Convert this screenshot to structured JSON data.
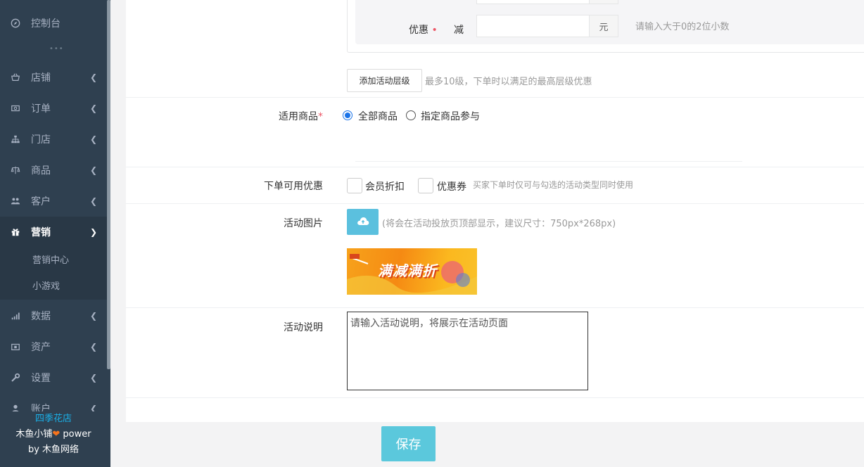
{
  "sidebar": {
    "top_item": "控制台",
    "dots": "•••",
    "items": [
      {
        "label": "店铺",
        "icon": "shop-icon"
      },
      {
        "label": "订单",
        "icon": "money-icon"
      },
      {
        "label": "门店",
        "icon": "sitemap-icon"
      },
      {
        "label": "商品",
        "icon": "balance-icon"
      },
      {
        "label": "客户",
        "icon": "users-icon"
      },
      {
        "label": "营销",
        "icon": "gift-icon"
      },
      {
        "label": "数据",
        "icon": "bar-chart-icon"
      },
      {
        "label": "资产",
        "icon": "wallet-icon"
      },
      {
        "label": "设置",
        "icon": "wrench-icon"
      },
      {
        "label": "账户",
        "icon": "user-icon"
      }
    ],
    "submenu": [
      "营销中心",
      "小游戏"
    ],
    "footer": {
      "shop_name": "四季花店",
      "brand": "木鱼小铺",
      "power": " power",
      "by": "by 木鱼网络"
    }
  },
  "form": {
    "discount_label": "优惠",
    "required_mark": "•",
    "minus_label": "减",
    "unit": "元",
    "discount_hint": "请输入大于0的2位小数",
    "add_tier_button": "添加活动层级",
    "add_tier_hint": "最多10级，下单时以满足的最高层级优惠",
    "goods_label": "适用商品",
    "goods_required": "*",
    "goods_options": [
      "全部商品",
      "指定商品参与"
    ],
    "combinable_label": "下单可用优惠",
    "combinable_options": [
      "会员折扣",
      "优惠券"
    ],
    "combinable_hint": "买家下单时仅可与勾选的活动类型同时使用",
    "image_label": "活动图片",
    "image_hint": "(将会在活动投放页顶部显示，建议尺寸：750px*268px)",
    "banner_text": "满减满折",
    "desc_label": "活动说明",
    "desc_placeholder": "请输入活动说明，将展示在活动页面",
    "save_button": "保存"
  },
  "colors": {
    "sidebar_bg": "#2f4050",
    "accent_blue": "#1ab0e8",
    "upload_btn": "#5bc0de",
    "save_btn": "#5bc8dc",
    "required_red": "#ed5565"
  }
}
